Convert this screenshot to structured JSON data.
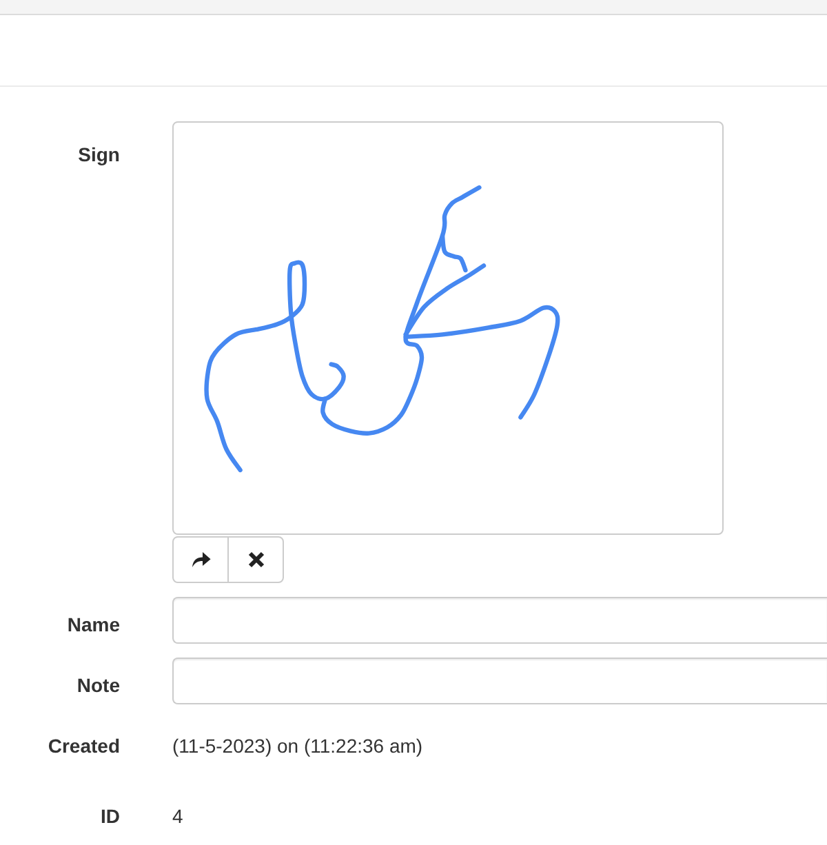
{
  "sign": {
    "label": "Sign",
    "buttons": [
      {
        "kind": "redo"
      },
      {
        "kind": "clear"
      }
    ]
  },
  "fields": [
    {
      "kind": "input",
      "label": "Name"
    },
    {
      "kind": "input",
      "label": "Note"
    },
    {
      "kind": "text",
      "label": "Created",
      "value": "(11-5-2023) on (11:22:36 am)"
    },
    {
      "kind": "text",
      "label": "ID",
      "value": "4"
    }
  ]
}
